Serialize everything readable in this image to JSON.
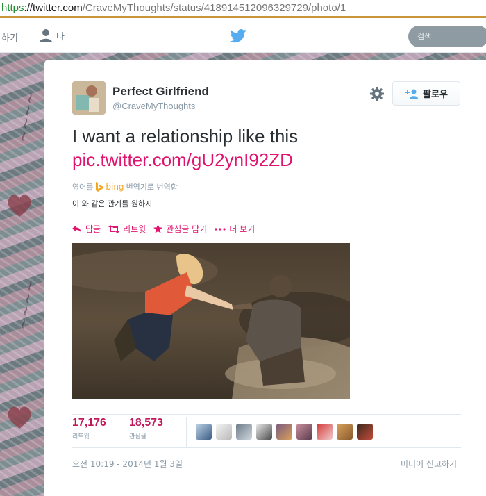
{
  "browser": {
    "url_scheme": "https",
    "url_host": "://twitter.com",
    "url_path": "/CraveMyThoughts/status/418914512096329729/photo/1"
  },
  "topnav": {
    "home_label": "하기",
    "me_label": "나",
    "search_placeholder": "검색",
    "brand_color": "#55acee"
  },
  "tweet": {
    "author": {
      "fullname": "Perfect Girlfriend",
      "username": "@CraveMyThoughts"
    },
    "follow_label": "팔로우",
    "text": "I want a relationship like this",
    "link": "pic.twitter.com/gU2ynI92ZD",
    "link_color": "#e0146e",
    "translate": {
      "prefix": "영어를",
      "provider": "bing",
      "suffix": "번역기로 번역함",
      "translation": "이 와 같은 관계를 원하지"
    },
    "actions": [
      {
        "label": "답글",
        "icon": "reply-icon"
      },
      {
        "label": "리트윗",
        "icon": "retweet-icon"
      },
      {
        "label": "관심글 담기",
        "icon": "star-icon"
      },
      {
        "label": "더 보기",
        "icon": "more-icon"
      }
    ],
    "stats": {
      "retweets": {
        "count": "17,176",
        "label": "리트윗"
      },
      "favorites": {
        "count": "18,573",
        "label": "관심글"
      }
    },
    "favoriter_avatars_count": 9,
    "timestamp": "오전 10:19 - 2014년 1월 3일",
    "report_label": "미디어 신고하기"
  }
}
